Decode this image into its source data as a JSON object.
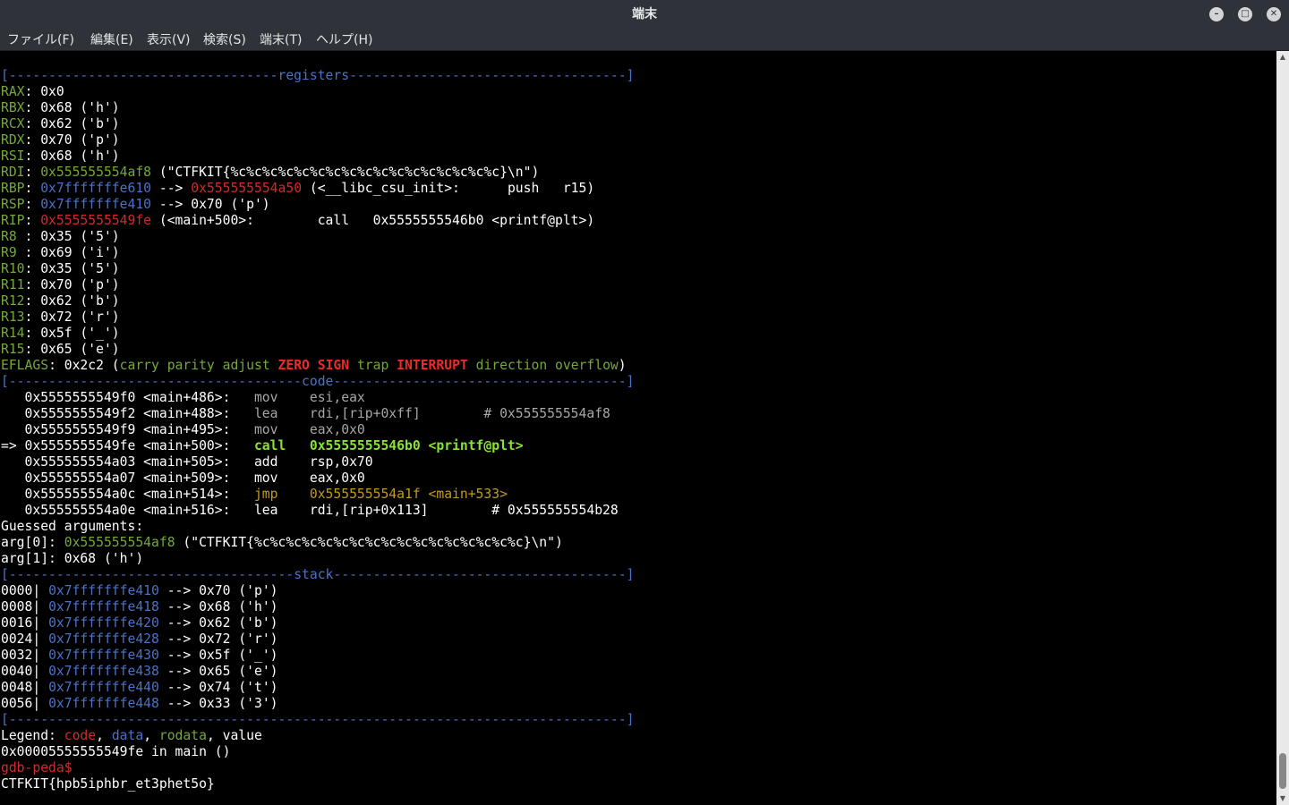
{
  "window": {
    "title": "端末"
  },
  "menu": [
    "ファイル(F)",
    "編集(E)",
    "表示(V)",
    "検索(S)",
    "端末(T)",
    "ヘルプ(H)"
  ],
  "terminal": {
    "lines": [
      [
        {
          "t": "[----------------------------------",
          "c": "sep"
        },
        {
          "t": "registers",
          "c": "b"
        },
        {
          "t": "-----------------------------------]",
          "c": "sep"
        }
      ],
      [
        {
          "t": "RAX",
          "c": "g"
        },
        {
          "t": ": 0x0"
        }
      ],
      [
        {
          "t": "RBX",
          "c": "g"
        },
        {
          "t": ": 0x68 ('h')"
        }
      ],
      [
        {
          "t": "RCX",
          "c": "g"
        },
        {
          "t": ": 0x62 ('b')"
        }
      ],
      [
        {
          "t": "RDX",
          "c": "g"
        },
        {
          "t": ": 0x70 ('p')"
        }
      ],
      [
        {
          "t": "RSI",
          "c": "g"
        },
        {
          "t": ": 0x68 ('h')"
        }
      ],
      [
        {
          "t": "RDI",
          "c": "g"
        },
        {
          "t": ": "
        },
        {
          "t": "0x555555554af8",
          "c": "g"
        },
        {
          "t": " (\"CTFKIT{%c%c%c%c%c%c%c%c%c%c%c%c%c%c%c%c%c}\\n\")"
        }
      ],
      [
        {
          "t": "RBP",
          "c": "g"
        },
        {
          "t": ": "
        },
        {
          "t": "0x7fffffffe610",
          "c": "b"
        },
        {
          "t": " --> "
        },
        {
          "t": "0x555555554a50",
          "c": "r"
        },
        {
          "t": " (<__libc_csu_init>:      push   r15)"
        }
      ],
      [
        {
          "t": "RSP",
          "c": "g"
        },
        {
          "t": ": "
        },
        {
          "t": "0x7fffffffe410",
          "c": "b"
        },
        {
          "t": " --> 0x70 ('p')"
        }
      ],
      [
        {
          "t": "RIP",
          "c": "g"
        },
        {
          "t": ": "
        },
        {
          "t": "0x5555555549fe",
          "c": "r"
        },
        {
          "t": " (<main+500>:        call   0x5555555546b0 <printf@plt>)"
        }
      ],
      [
        {
          "t": "R8 ",
          "c": "g"
        },
        {
          "t": ": 0x35 ('5')"
        }
      ],
      [
        {
          "t": "R9 ",
          "c": "g"
        },
        {
          "t": ": 0x69 ('i')"
        }
      ],
      [
        {
          "t": "R10",
          "c": "g"
        },
        {
          "t": ": 0x35 ('5')"
        }
      ],
      [
        {
          "t": "R11",
          "c": "g"
        },
        {
          "t": ": 0x70 ('p')"
        }
      ],
      [
        {
          "t": "R12",
          "c": "g"
        },
        {
          "t": ": 0x62 ('b')"
        }
      ],
      [
        {
          "t": "R13",
          "c": "g"
        },
        {
          "t": ": 0x72 ('r')"
        }
      ],
      [
        {
          "t": "R14",
          "c": "g"
        },
        {
          "t": ": 0x5f ('_')"
        }
      ],
      [
        {
          "t": "R15",
          "c": "g"
        },
        {
          "t": ": 0x65 ('e')"
        }
      ],
      [
        {
          "t": "EFLAGS",
          "c": "g"
        },
        {
          "t": ": 0x2c2 ("
        },
        {
          "t": "carry parity adjust ",
          "c": "g"
        },
        {
          "t": "ZERO SIGN",
          "c": "br"
        },
        {
          "t": " trap ",
          "c": "g"
        },
        {
          "t": "INTERRUPT",
          "c": "br"
        },
        {
          "t": " direction overflow",
          "c": "g"
        },
        {
          "t": ")"
        }
      ],
      [
        {
          "t": "[-------------------------------------",
          "c": "sep"
        },
        {
          "t": "code",
          "c": "b"
        },
        {
          "t": "-------------------------------------]",
          "c": "sep"
        }
      ],
      [
        {
          "t": "   0x5555555549f0 <main+486>:   "
        },
        {
          "t": "mov    esi,eax",
          "c": "gray"
        }
      ],
      [
        {
          "t": "   0x5555555549f2 <main+488>:   "
        },
        {
          "t": "lea    rdi,[rip+0xff]        # 0x555555554af8",
          "c": "gray"
        }
      ],
      [
        {
          "t": "   0x5555555549f9 <main+495>:   "
        },
        {
          "t": "mov    eax,0x0",
          "c": "gray"
        }
      ],
      [
        {
          "t": "=> 0x5555555549fe <main+500>:   "
        },
        {
          "t": "call   0x5555555546b0 <printf@plt>",
          "c": "bg"
        }
      ],
      [
        {
          "t": "   0x555555554a03 <main+505>:   add    rsp,0x70"
        }
      ],
      [
        {
          "t": "   0x555555554a07 <main+509>:   mov    eax,0x0"
        }
      ],
      [
        {
          "t": "   0x555555554a0c <main+514>:   "
        },
        {
          "t": "jmp    0x555555554a1f <main+533>",
          "c": "y"
        }
      ],
      [
        {
          "t": "   0x555555554a0e <main+516>:   lea    rdi,[rip+0x113]        # 0x555555554b28"
        }
      ],
      [
        {
          "t": "Guessed arguments:"
        }
      ],
      [
        {
          "t": "arg[0]: "
        },
        {
          "t": "0x555555554af8",
          "c": "g"
        },
        {
          "t": " (\"CTFKIT{%c%c%c%c%c%c%c%c%c%c%c%c%c%c%c%c%c}\\n\")"
        }
      ],
      [
        {
          "t": "arg[1]: 0x68 ('h')"
        }
      ],
      [
        {
          "t": "[------------------------------------",
          "c": "sep"
        },
        {
          "t": "stack",
          "c": "b"
        },
        {
          "t": "-------------------------------------]",
          "c": "sep"
        }
      ],
      [
        {
          "t": "0000| "
        },
        {
          "t": "0x7fffffffe410",
          "c": "b"
        },
        {
          "t": " --> 0x70 ('p')"
        }
      ],
      [
        {
          "t": "0008| "
        },
        {
          "t": "0x7fffffffe418",
          "c": "b"
        },
        {
          "t": " --> 0x68 ('h')"
        }
      ],
      [
        {
          "t": "0016| "
        },
        {
          "t": "0x7fffffffe420",
          "c": "b"
        },
        {
          "t": " --> 0x62 ('b')"
        }
      ],
      [
        {
          "t": "0024| "
        },
        {
          "t": "0x7fffffffe428",
          "c": "b"
        },
        {
          "t": " --> 0x72 ('r')"
        }
      ],
      [
        {
          "t": "0032| "
        },
        {
          "t": "0x7fffffffe430",
          "c": "b"
        },
        {
          "t": " --> 0x5f ('_')"
        }
      ],
      [
        {
          "t": "0040| "
        },
        {
          "t": "0x7fffffffe438",
          "c": "b"
        },
        {
          "t": " --> 0x65 ('e')"
        }
      ],
      [
        {
          "t": "0048| "
        },
        {
          "t": "0x7fffffffe440",
          "c": "b"
        },
        {
          "t": " --> 0x74 ('t')"
        }
      ],
      [
        {
          "t": "0056| "
        },
        {
          "t": "0x7fffffffe448",
          "c": "b"
        },
        {
          "t": " --> 0x33 ('3')"
        }
      ],
      [
        {
          "t": "[------------------------------------------------------------------------------]",
          "c": "sep"
        }
      ],
      [
        {
          "t": "Legend: "
        },
        {
          "t": "code",
          "c": "r"
        },
        {
          "t": ", "
        },
        {
          "t": "data",
          "c": "b"
        },
        {
          "t": ", "
        },
        {
          "t": "rodata",
          "c": "g"
        },
        {
          "t": ", value"
        }
      ],
      [
        {
          "t": "0x00005555555549fe in main ()"
        }
      ],
      [
        {
          "t": "gdb-peda$",
          "c": "r"
        }
      ],
      [
        {
          "t": "CTFKIT{hpb5iphbr_et3phet5o}"
        }
      ]
    ]
  },
  "colors": {
    "titlebar": "#2f3339",
    "background": "#000000",
    "green": "#74a83a",
    "blue": "#4b72c8",
    "red": "#d12a2a",
    "yellow": "#c29a1f"
  },
  "icons": {
    "minimize": "minimize-icon",
    "maximize": "maximize-icon",
    "close": "close-icon"
  }
}
